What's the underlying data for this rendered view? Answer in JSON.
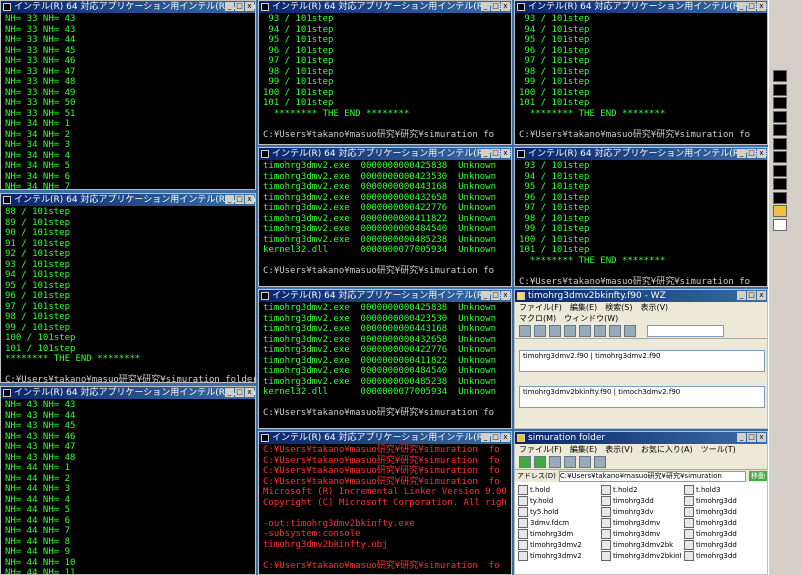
{
  "console_title": "インテル(R) 64 対応アプリケーション用インテル(R) Visual F",
  "w1": {
    "lines": [
      "NH= 33 NH= 43",
      "NH= 33 NH= 43",
      "NH= 33 NH= 44",
      "NH= 33 NH= 45",
      "NH= 33 NH= 46",
      "NH= 33 NH= 47",
      "NH= 33 NH= 48",
      "NH= 33 NH= 49",
      "NH= 33 NH= 50",
      "NH= 33 NH= 51",
      "NH= 34 NH= 1",
      "NH= 34 NH= 2",
      "NH= 34 NH= 3",
      "NH= 34 NH= 4",
      "NH= 34 NH= 5",
      "NH= 34 NH= 6",
      "NH= 34 NH= 7"
    ]
  },
  "w2": {
    "lines": [
      "88 / 101step",
      "89 / 101step",
      "90 / 101step",
      "91 / 101step",
      "92 / 101step",
      "93 / 101step",
      "94 / 101step",
      "95 / 101step",
      "96 / 101step",
      "97 / 101step",
      "98 / 101step",
      "99 / 101step",
      "100 / 101step",
      "101 / 101step",
      "******** THE END ********",
      "",
      "C:¥Users¥takano¥masuo研究¥研究¥simuration folder>"
    ]
  },
  "w3": {
    "lines": [
      "NH= 43 NH= 43",
      "NH= 43 NH= 44",
      "NH= 43 NH= 45",
      "NH= 43 NH= 46",
      "NH= 43 NH= 47",
      "NH= 43 NH= 48",
      "NH= 44 NH= 1",
      "NH= 44 NH= 2",
      "NH= 44 NH= 3",
      "NH= 44 NH= 4",
      "NH= 44 NH= 5",
      "NH= 44 NH= 6",
      "NH= 44 NH= 7",
      "NH= 44 NH= 8",
      "NH= 44 NH= 9",
      "NH= 44 NH= 10",
      "NH= 44 NH= 11"
    ]
  },
  "w4": {
    "lines": [
      " 93 / 101step",
      " 94 / 101step",
      " 95 / 101step",
      " 96 / 101step",
      " 97 / 101step",
      " 98 / 101step",
      " 99 / 101step",
      "100 / 101step",
      "101 / 101step",
      "  ******** THE END ********",
      "",
      "C:¥Users¥takano¥masuo研究¥研究¥simuration fo"
    ]
  },
  "w5": {
    "lines": [
      "timohrg3dmv2.exe  0000000000425838  Unknown",
      "timohrg3dmv2.exe  0000000000423530  Unknown",
      "timohrg3dmv2.exe  0000000000443168  Unknown",
      "timohrg3dmv2.exe  0000000000432658  Unknown",
      "timohrg3dmv2.exe  0000000000422776  Unknown",
      "timohrg3dmv2.exe  0000000000411822  Unknown",
      "timohrg3dmv2.exe  0000000000484540  Unknown",
      "timohrg3dmv2.exe  0000000000485238  Unknown",
      "kernel32.dll      0000000077005934  Unknown",
      "",
      "C:¥Users¥takano¥masuo研究¥研究¥simuration fo"
    ]
  },
  "w6": {
    "lines": [
      "timohrg3dmv2.exe  0000000000425838  Unknown",
      "timohrg3dmv2.exe  0000000000423530  Unknown",
      "timohrg3dmv2.exe  0000000000443168  Unknown",
      "timohrg3dmv2.exe  0000000000432658  Unknown",
      "timohrg3dmv2.exe  0000000000422776  Unknown",
      "timohrg3dmv2.exe  0000000000411822  Unknown",
      "timohrg3dmv2.exe  0000000000484540  Unknown",
      "timohrg3dmv2.exe  0000000000485238  Unknown",
      "kernel32.dll      0000000077005934  Unknown",
      "",
      "C:¥Users¥takano¥masuo研究¥研究¥simuration fo"
    ]
  },
  "w7": {
    "lines": [
      "C:¥Users¥takano¥masuo研究¥研究¥simuration  fo",
      "C:¥Users¥takano¥masuo研究¥研究¥simuration  fo",
      "C:¥Users¥takano¥masuo研究¥研究¥simuration  fo",
      "C:¥Users¥takano¥masuo研究¥研究¥simuration  fo",
      "Microsoft (R) Incremental Linker Version 9.00",
      "Copyright (C) Microsoft Corporation. All righ",
      "",
      "-out:timohrg3dmv2bkinfty.exe",
      "-subsystem:console",
      "timohrg3dmv2bkinfty.obj",
      "",
      "C:¥Users¥takano¥masuo研究¥研究¥simuration  fo"
    ]
  },
  "w8": {
    "lines": [
      " 93 / 101step",
      " 94 / 101step",
      " 95 / 101step",
      " 96 / 101step",
      " 97 / 101step",
      " 98 / 101step",
      " 99 / 101step",
      "100 / 101step",
      "101 / 101step",
      "  ******** THE END ********",
      "",
      "C:¥Users¥takano¥masuo研究¥研究¥simuration fo"
    ]
  },
  "w9": {
    "lines": [
      " 93 / 101step",
      " 94 / 101step",
      " 95 / 101step",
      " 96 / 101step",
      " 97 / 101step",
      " 98 / 101step",
      " 99 / 101step",
      "100 / 101step",
      "101 / 101step",
      "  ******** THE END ********",
      "",
      "C:¥Users¥takano¥masuo研究¥研究¥simuration fo"
    ]
  },
  "editor": {
    "title": "timohrg3dmv2bkinfty.f90 - WZ",
    "menu": [
      "ファイル(F)",
      "編集(E)",
      "検索(S)",
      "表示(V)"
    ],
    "menu2": [
      "マクロ(M)",
      "ウィンドウ(W)"
    ],
    "box1": "timohrg3dmv2.f90 | timohrg3dmv2.f90",
    "box2": "timohrg3dmv2bkinfty.f90 | timoch3dmv2.f90"
  },
  "explorer": {
    "title": "simuration folder",
    "menu": [
      "ファイル(F)",
      "編集(E)",
      "表示(V)",
      "お気に入り(A)",
      "ツール(T)"
    ],
    "address_label": "アドレス(D)",
    "address": "C:¥Users¥takano¥masuo研究¥研究¥simuration",
    "go": "移動",
    "files": [
      "t.hold",
      "t.hold2",
      "t.hold3",
      "ty.hold",
      "timohrg3dd",
      "timohrg3dd",
      "ty5.hold",
      "timohrg3dv",
      "timohrg3dd",
      "3dmv.fdcm",
      "timohrg3dmv",
      "timohrg3dd",
      "timohrg3dm",
      "timohrg3dmv",
      "timohrg3dd",
      "timohrg3dmv2",
      "timohrg3dmv2bk",
      "timohrg3dd",
      "timohrg3dmv2",
      "timohrg3dmv2bkinfty",
      "timohrg3dd"
    ]
  },
  "tray": {
    "items": [
      "ie-icon",
      "speaker-icon",
      "cmd-icon",
      "cmd-icon",
      "cmd-icon",
      "cmd-icon",
      "cmd-icon",
      "cmd-icon",
      "cmd-icon",
      "cmd-icon",
      "cmd-icon",
      "cmd-icon",
      "folder-icon",
      "editor-icon"
    ]
  }
}
